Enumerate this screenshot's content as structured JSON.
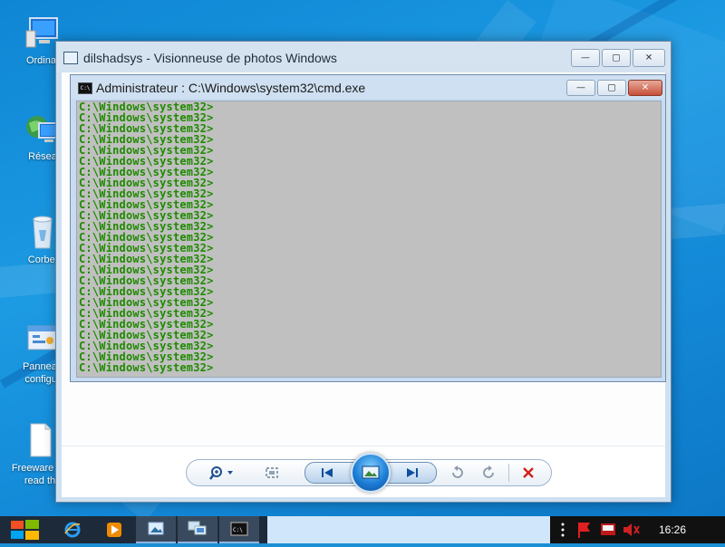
{
  "desktop": {
    "icons": [
      {
        "label": "Ordinat"
      },
      {
        "label": "Résea"
      },
      {
        "label": "Corbei"
      },
      {
        "label_line1": "Panneau",
        "label_line2": "configur"
      },
      {
        "label_line1": "Freeware Sy",
        "label_line2": "read th"
      }
    ]
  },
  "viewer": {
    "title": "dilshadsys - Visionneuse de photos Windows",
    "buttons": {
      "minimize": "—",
      "maximize": "▢",
      "close": "✕"
    },
    "controls": {
      "zoom_icon": "magnifier-icon",
      "fit_icon": "fit-window-icon",
      "prev_icon": "previous-icon",
      "slideshow_icon": "slideshow-icon",
      "next_icon": "next-icon",
      "rotate_left_icon": "rotate-counterclockwise-icon",
      "rotate_right_icon": "rotate-clockwise-icon",
      "delete_icon": "delete-icon"
    }
  },
  "cmd": {
    "title": "Administrateur : C:\\Windows\\system32\\cmd.exe",
    "icon_text": "C:\\",
    "lines": [
      "C:\\Windows\\system32>",
      "C:\\Windows\\system32>",
      "C:\\Windows\\system32>",
      "C:\\Windows\\system32>",
      "C:\\Windows\\system32>",
      "C:\\Windows\\system32>",
      "C:\\Windows\\system32>",
      "C:\\Windows\\system32>",
      "C:\\Windows\\system32>",
      "C:\\Windows\\system32>",
      "C:\\Windows\\system32>",
      "C:\\Windows\\system32>",
      "C:\\Windows\\system32>",
      "C:\\Windows\\system32>",
      "C:\\Windows\\system32>",
      "C:\\Windows\\system32>",
      "C:\\Windows\\system32>",
      "C:\\Windows\\system32>",
      "C:\\Windows\\system32>",
      "C:\\Windows\\system32>",
      "C:\\Windows\\system32>",
      "C:\\Windows\\system32>",
      "C:\\Windows\\system32>",
      "C:\\Windows\\system32>",
      "C:\\Windows\\system32>"
    ]
  },
  "taskbar": {
    "apps": [
      "internet-explorer-icon",
      "media-player-icon",
      "photo-viewer-icon",
      "remote-desktop-icon",
      "cmd-icon"
    ],
    "tray_icons": [
      "more-icon",
      "flag-icon",
      "network-icon",
      "volume-muted-icon"
    ],
    "clock": "16:26"
  },
  "colors": {
    "console_text": "#1f8a00",
    "console_bg": "#c0c0c0",
    "desktop_bg": "#1a8fd6",
    "taskbar_bg": "#1d2a3a"
  }
}
